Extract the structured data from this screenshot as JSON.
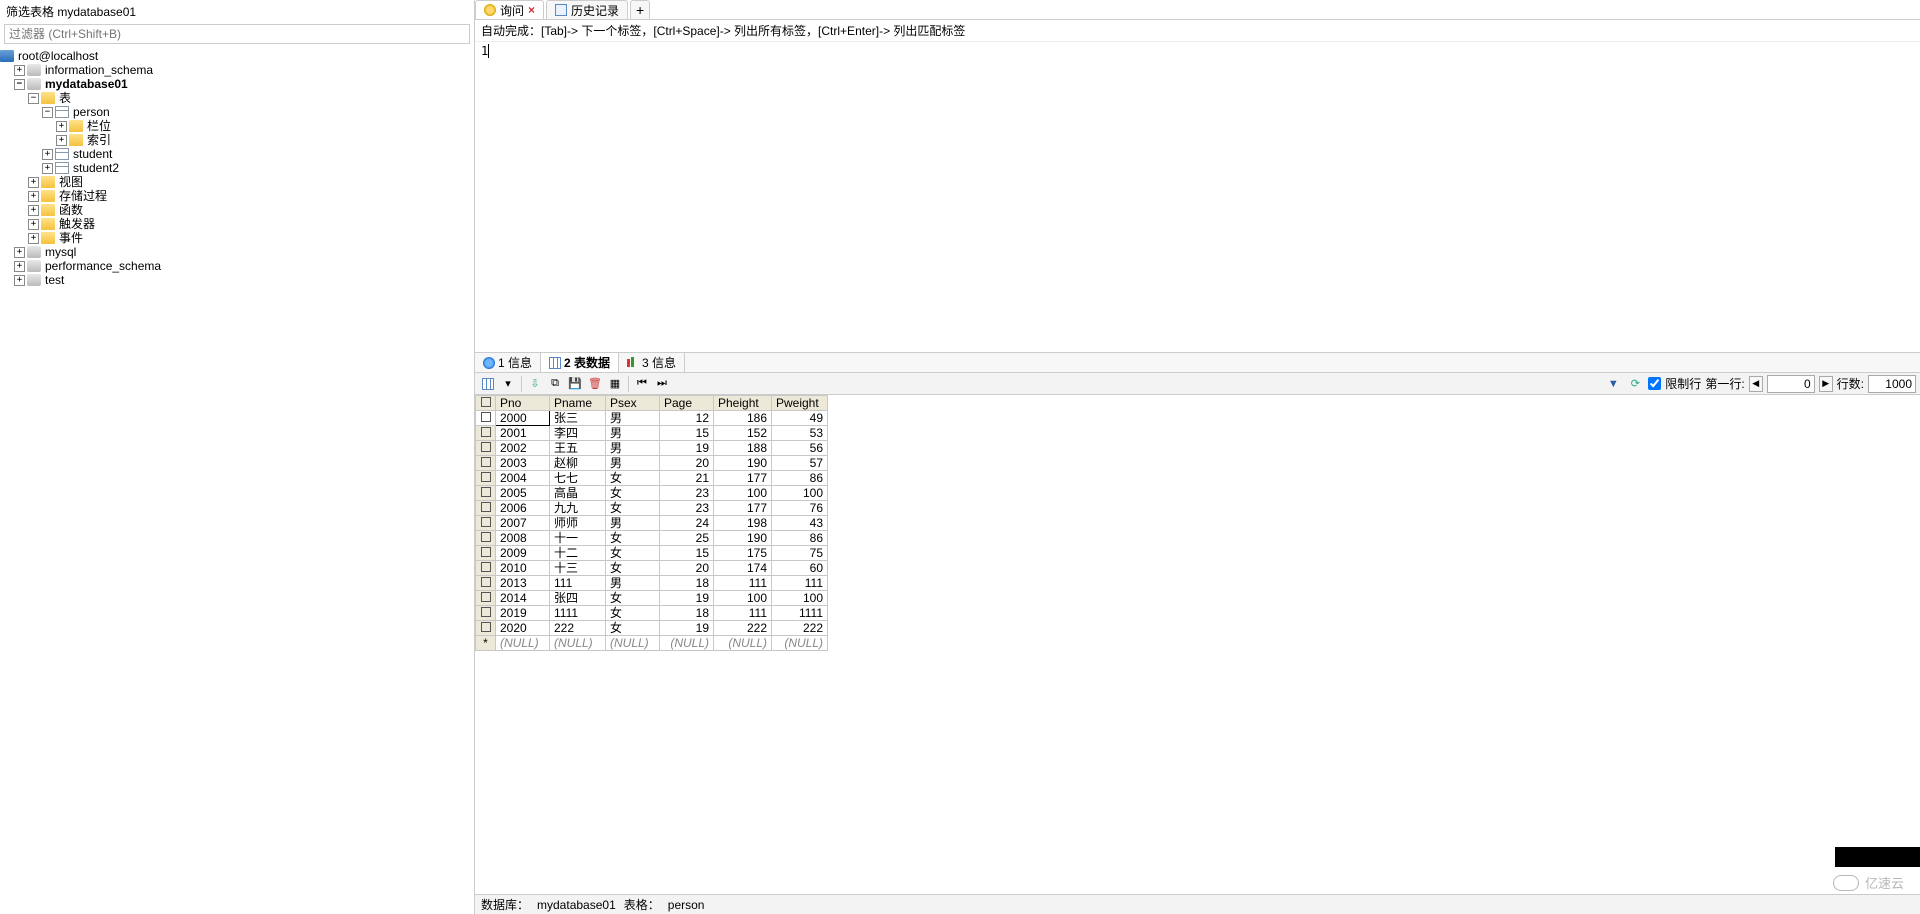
{
  "filter": {
    "title": "筛选表格 mydatabase01",
    "placeholder": "过滤器 (Ctrl+Shift+B)"
  },
  "tree": {
    "root": "root@localhost",
    "dbs": [
      "information_schema",
      "mydatabase01",
      "mysql",
      "performance_schema",
      "test"
    ],
    "active_db": "mydatabase01",
    "folders": {
      "tables": "表",
      "views": "视图",
      "procs": "存储过程",
      "funcs": "函数",
      "triggers": "触发器",
      "events": "事件"
    },
    "tables": [
      "person",
      "student",
      "student2"
    ],
    "person_children": {
      "columns": "栏位",
      "indexes": "索引"
    }
  },
  "tabs": {
    "query": "询问",
    "history": "历史记录"
  },
  "hint": "自动完成：[Tab]-> 下一个标签，[Ctrl+Space]-> 列出所有标签，[Ctrl+Enter]-> 列出匹配标签",
  "editor_line1": "1",
  "subtabs": {
    "info": "1 信息",
    "data": "2 表数据",
    "info3": "3 信息"
  },
  "toolbar": {
    "limit_label": "限制行",
    "first_row_label": "第一行:",
    "first_row_value": "0",
    "row_count_label": "行数:",
    "row_count_value": "1000"
  },
  "grid": {
    "columns": [
      "Pno",
      "Pname",
      "Psex",
      "Page",
      "Pheight",
      "Pweight"
    ],
    "rows": [
      {
        "Pno": "2000",
        "Pname": "张三",
        "Psex": "男",
        "Page": "12",
        "Pheight": "186",
        "Pweight": "49"
      },
      {
        "Pno": "2001",
        "Pname": "李四",
        "Psex": "男",
        "Page": "15",
        "Pheight": "152",
        "Pweight": "53"
      },
      {
        "Pno": "2002",
        "Pname": "王五",
        "Psex": "男",
        "Page": "19",
        "Pheight": "188",
        "Pweight": "56"
      },
      {
        "Pno": "2003",
        "Pname": "赵柳",
        "Psex": "男",
        "Page": "20",
        "Pheight": "190",
        "Pweight": "57"
      },
      {
        "Pno": "2004",
        "Pname": "七七",
        "Psex": "女",
        "Page": "21",
        "Pheight": "177",
        "Pweight": "86"
      },
      {
        "Pno": "2005",
        "Pname": "高晶",
        "Psex": "女",
        "Page": "23",
        "Pheight": "100",
        "Pweight": "100"
      },
      {
        "Pno": "2006",
        "Pname": "九九",
        "Psex": "女",
        "Page": "23",
        "Pheight": "177",
        "Pweight": "76"
      },
      {
        "Pno": "2007",
        "Pname": "师师",
        "Psex": "男",
        "Page": "24",
        "Pheight": "198",
        "Pweight": "43"
      },
      {
        "Pno": "2008",
        "Pname": "十一",
        "Psex": "女",
        "Page": "25",
        "Pheight": "190",
        "Pweight": "86"
      },
      {
        "Pno": "2009",
        "Pname": "十二",
        "Psex": "女",
        "Page": "15",
        "Pheight": "175",
        "Pweight": "75"
      },
      {
        "Pno": "2010",
        "Pname": "十三",
        "Psex": "女",
        "Page": "20",
        "Pheight": "174",
        "Pweight": "60"
      },
      {
        "Pno": "2013",
        "Pname": "111",
        "Psex": "男",
        "Page": "18",
        "Pheight": "111",
        "Pweight": "111"
      },
      {
        "Pno": "2014",
        "Pname": "张四",
        "Psex": "女",
        "Page": "19",
        "Pheight": "100",
        "Pweight": "100"
      },
      {
        "Pno": "2019",
        "Pname": "1111",
        "Psex": "女",
        "Page": "18",
        "Pheight": "111",
        "Pweight": "1111"
      },
      {
        "Pno": "2020",
        "Pname": "222",
        "Psex": "女",
        "Page": "19",
        "Pheight": "222",
        "Pweight": "222"
      }
    ],
    "null_text": "(NULL)"
  },
  "status": {
    "db_label": "数据库：",
    "db_value": "mydatabase01",
    "table_label": "表格：",
    "table_value": "person"
  },
  "watermark": "亿速云"
}
